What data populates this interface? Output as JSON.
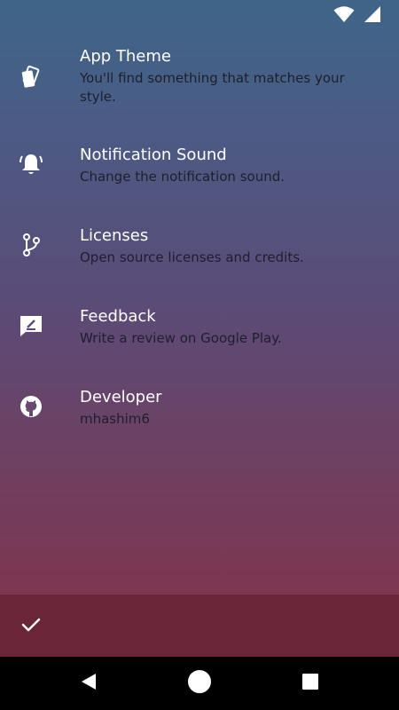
{
  "status_bar": {
    "icons": [
      "wifi-icon",
      "cellular-signal-icon"
    ]
  },
  "settings": [
    {
      "icon": "palette-cards-icon",
      "title": "App Theme",
      "subtitle": "You'll find something that matches your style."
    },
    {
      "icon": "bell-icon",
      "title": "Notification Sound",
      "subtitle": "Change the notification sound."
    },
    {
      "icon": "fork-icon",
      "title": "Licenses",
      "subtitle": "Open source licenses and credits."
    },
    {
      "icon": "feedback-pencil-icon",
      "title": "Feedback",
      "subtitle": "Write a review on Google Play."
    },
    {
      "icon": "github-icon",
      "title": "Developer",
      "subtitle": "mhashim6"
    }
  ],
  "bottom_bar": {
    "action_icon": "check-icon"
  },
  "nav_bar": {
    "buttons": [
      "back-icon",
      "home-icon",
      "recents-icon"
    ]
  },
  "colors": {
    "gradient_top": "#3e6588",
    "gradient_bottom": "#7d3650",
    "bottom_bar": "#6a2539",
    "title_text": "#ffffff",
    "subtitle_text": "#1e1f2d"
  }
}
